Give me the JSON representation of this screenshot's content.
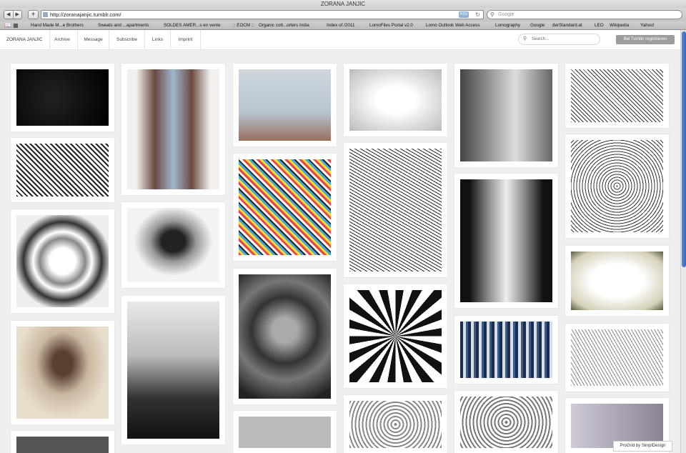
{
  "browser": {
    "window_title": "ZORANA JANJIC",
    "url": "http://zoranajanjic.tumblr.com/",
    "search_placeholder": "Google",
    "bookmarks": [
      "Hand Made M...e Brothers",
      "Sweats and ...apartments",
      "SOLDES AMER...s en vente",
      ":: EOCM ::",
      "Organic cott...orters India",
      "Index of /2011",
      "LomoFiles Portal v2.0",
      "Lomo Outlook Web Access",
      "Lomography",
      "Google",
      "derStandard.at",
      "LEO",
      "Wikipedia",
      "Yahoo!"
    ]
  },
  "nav": {
    "brand": "ZORANA JANJIC",
    "tabs": [
      "Archive",
      "Message",
      "Subscribe",
      "Links",
      "Imprint"
    ],
    "search_placeholder": "Search...",
    "register_label": "Bei Tumblr registrieren"
  },
  "footer_credit": "ProGrid by SimplDesign",
  "colors": {
    "scroll_thumb": "#3a66b8",
    "register_button": "#9c9c9c"
  },
  "icons": [
    "back-icon",
    "forward-icon",
    "plus-icon",
    "rss-icon",
    "reload-icon",
    "search-icon",
    "bookmarks-icon",
    "grid-icon"
  ]
}
